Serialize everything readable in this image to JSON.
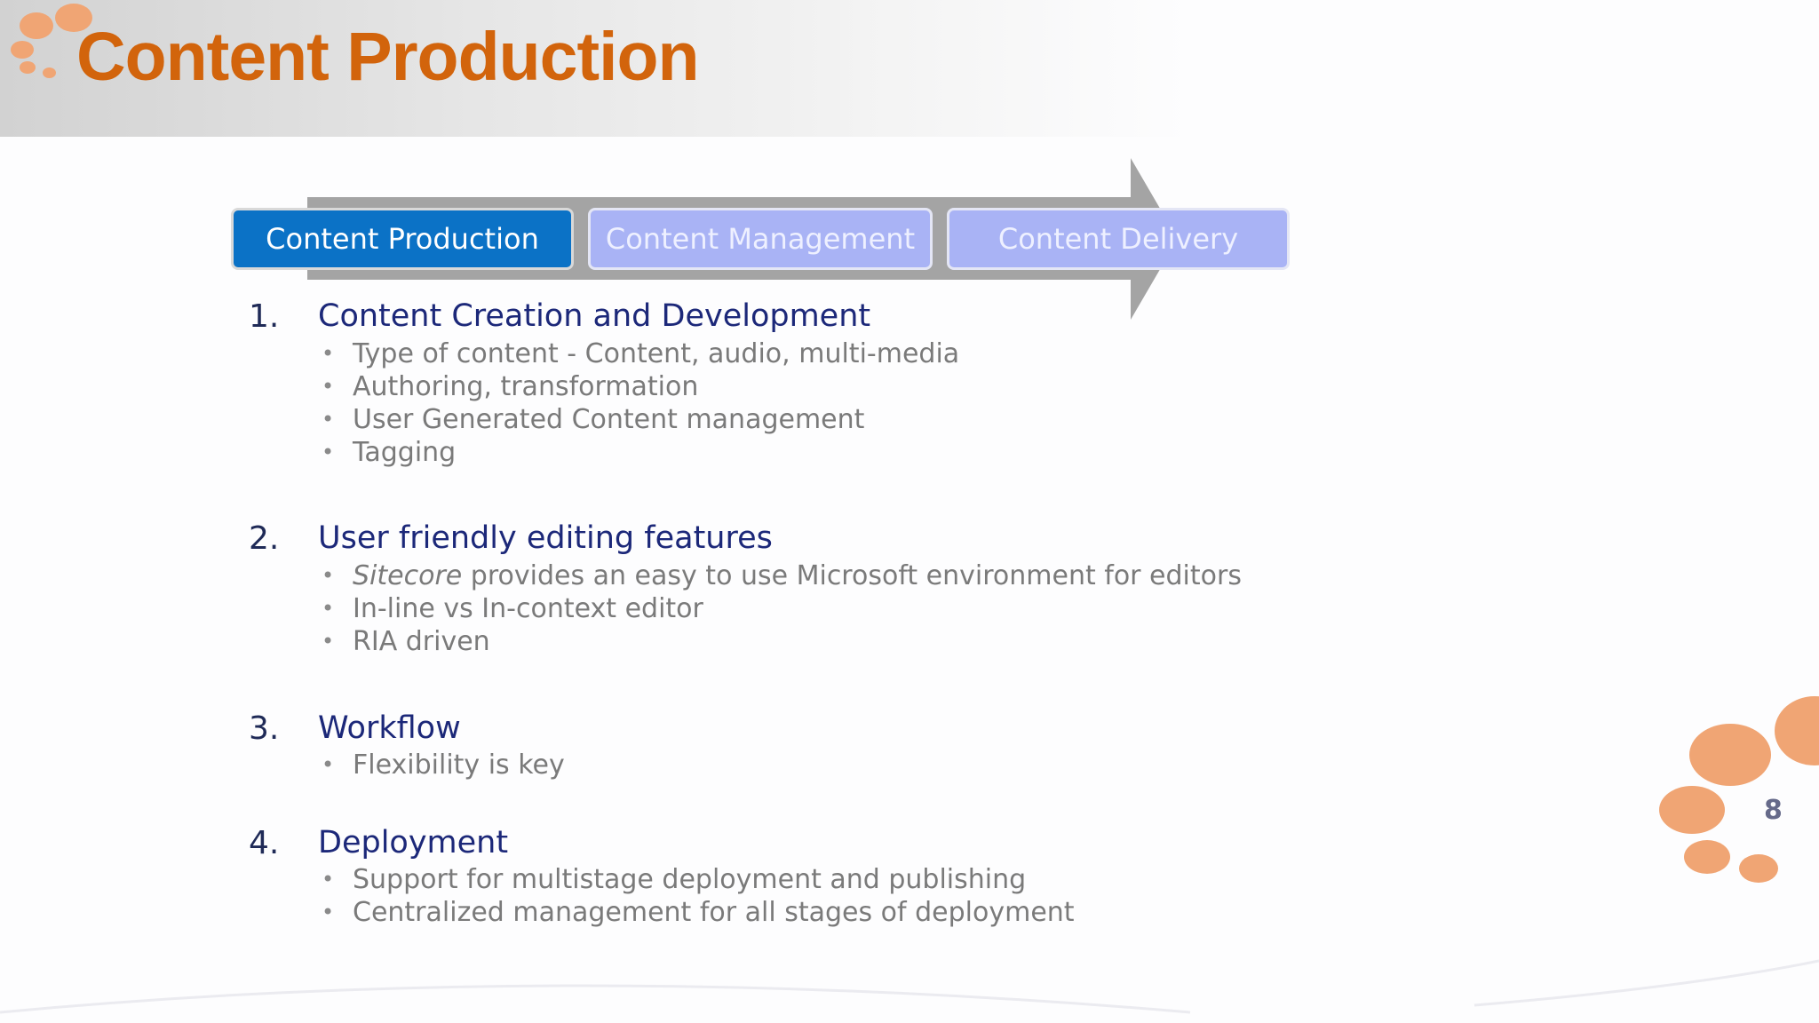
{
  "slide": {
    "title": "Content Production",
    "page_number": "8"
  },
  "flow": {
    "steps": [
      {
        "label": "Content Production",
        "state": "active"
      },
      {
        "label": "Content Management",
        "state": "inactive"
      },
      {
        "label": "Content Delivery",
        "state": "inactive"
      }
    ]
  },
  "sections": [
    {
      "number": "1.",
      "title": "Content Creation and Development",
      "bullets": [
        "Type of content - Content, audio,  multi-media",
        "Authoring, transformation",
        "User Generated Content management",
        "Tagging"
      ]
    },
    {
      "number": "2.",
      "title": "User friendly editing features",
      "bullets": [
        {
          "emphasis": "Sitecore",
          "rest": " provides an easy to use Microsoft environment for editors"
        },
        "In-line vs In-context editor",
        "RIA driven"
      ]
    },
    {
      "number": "3.",
      "title": "Workflow",
      "bullets": [
        "Flexibility is key"
      ]
    },
    {
      "number": "4.",
      "title": "Deployment",
      "bullets": [
        "Support for multistage deployment and publishing",
        "Centralized management for all stages of deployment"
      ]
    }
  ],
  "colors": {
    "title": "#d2640c",
    "accent_dots": "#f0a574",
    "step_active": "#0b72c6",
    "step_inactive": "#a9b3f5",
    "section_title": "#1c2879",
    "bullet_text": "#7a7a7a"
  },
  "icons": [
    "decorative-dots-icon",
    "flow-arrow-icon"
  ]
}
